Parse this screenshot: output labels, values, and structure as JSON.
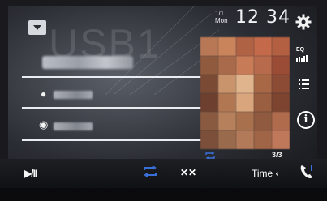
{
  "status": {
    "date_top": "1/1",
    "date_bottom": "Mon",
    "clock": "12 34"
  },
  "background_text": "USB1",
  "sidebar": {
    "eq_label": "EQ",
    "track_counter": "3/3"
  },
  "bottom_bar": {
    "play_pause_label": "▶/II",
    "shuffle_label": "✕✕",
    "time_label": "Time ‹"
  },
  "colors": {
    "accent_blue": "#3b6fd8",
    "text_white": "#f0f2f5"
  }
}
